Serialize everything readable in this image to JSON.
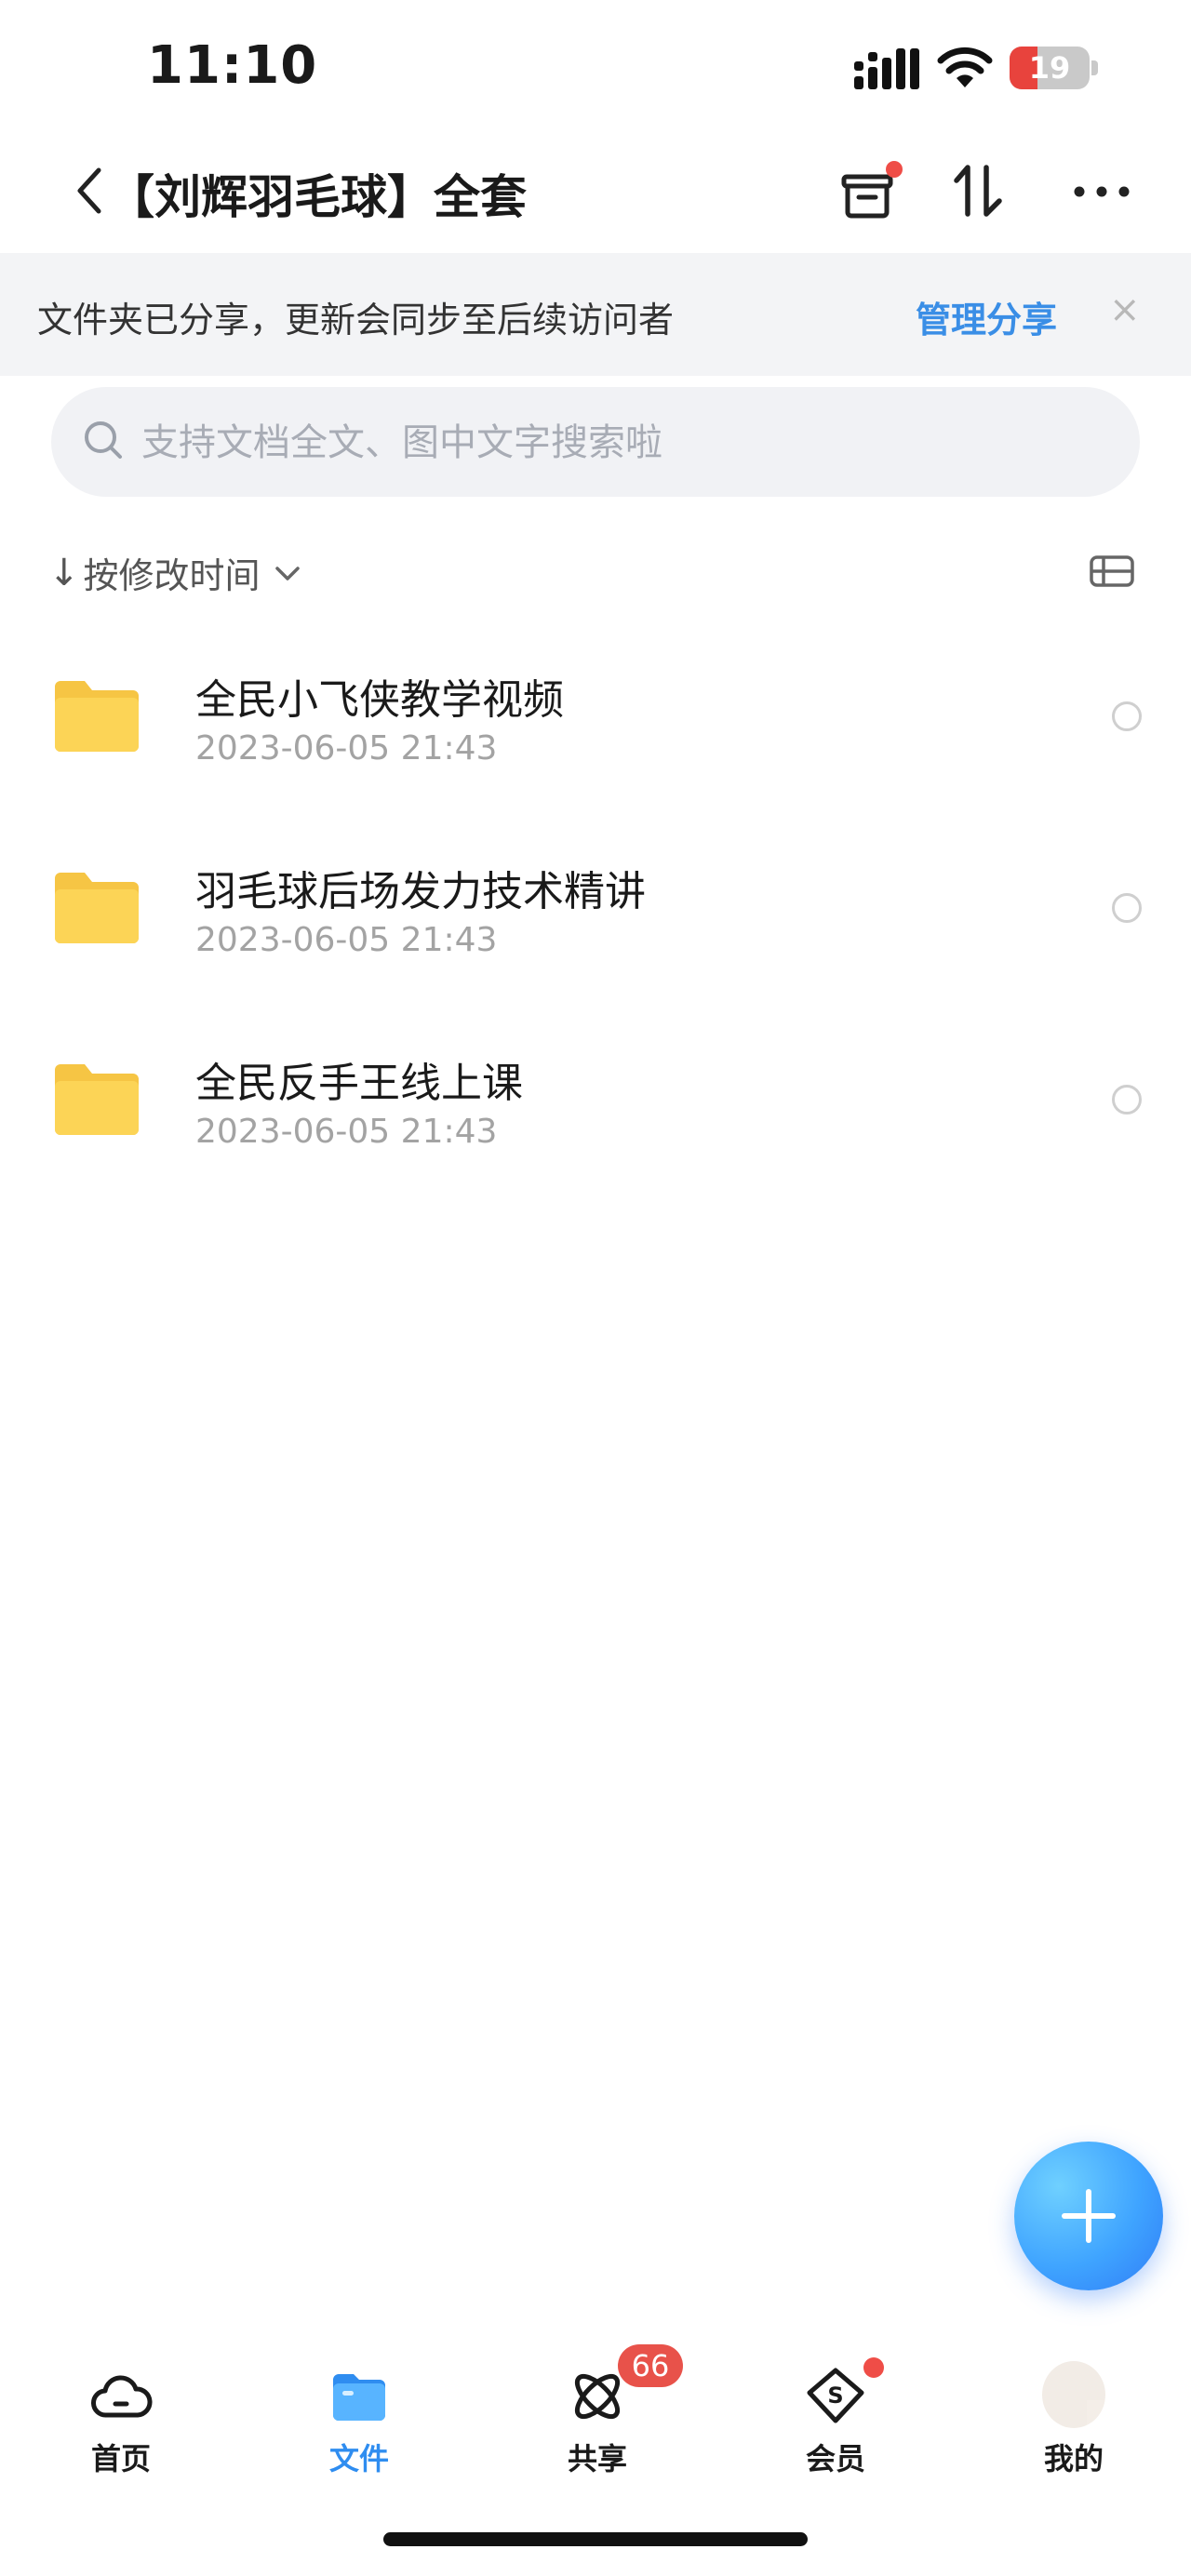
{
  "status_bar": {
    "time": "11:10",
    "battery_level": "19",
    "battery_fraction": 0.19,
    "icons": [
      "signal-icon",
      "wifi-icon",
      "battery-icon"
    ]
  },
  "header": {
    "title": "【刘辉羽毛球】全套",
    "icons": [
      "back-icon",
      "archive-icon",
      "sort-toggle-icon",
      "more-icon"
    ]
  },
  "share_banner": {
    "text": "文件夹已分享，更新会同步至后续访问者",
    "manage_label": "管理分享",
    "close_symbol": "×"
  },
  "search": {
    "placeholder": "支持文档全文、图中文字搜索啦",
    "value": ""
  },
  "sort": {
    "arrow": "↓",
    "label": "按修改时间"
  },
  "files": [
    {
      "name": "全民小飞侠教学视频",
      "date": "2023-06-05 21:43",
      "icon": "folder-icon"
    },
    {
      "name": "羽毛球后场发力技术精讲",
      "date": "2023-06-05 21:43",
      "icon": "folder-icon"
    },
    {
      "name": "全民反手王线上课",
      "date": "2023-06-05 21:43",
      "icon": "folder-icon"
    }
  ],
  "nav": {
    "items": [
      {
        "label": "首页",
        "icon": "cloud-icon"
      },
      {
        "label": "文件",
        "icon": "folder-icon",
        "active": true
      },
      {
        "label": "共享",
        "icon": "share-atom-icon",
        "badge": "66"
      },
      {
        "label": "会员",
        "icon": "vip-diamond-icon"
      },
      {
        "label": "我的",
        "icon": "avatar"
      }
    ]
  },
  "colors": {
    "accent": "#2f8df0",
    "link": "#3a8ee6",
    "badge": "#e8524a",
    "folder": "#fcd456",
    "banner_bg": "#f3f4f6"
  }
}
